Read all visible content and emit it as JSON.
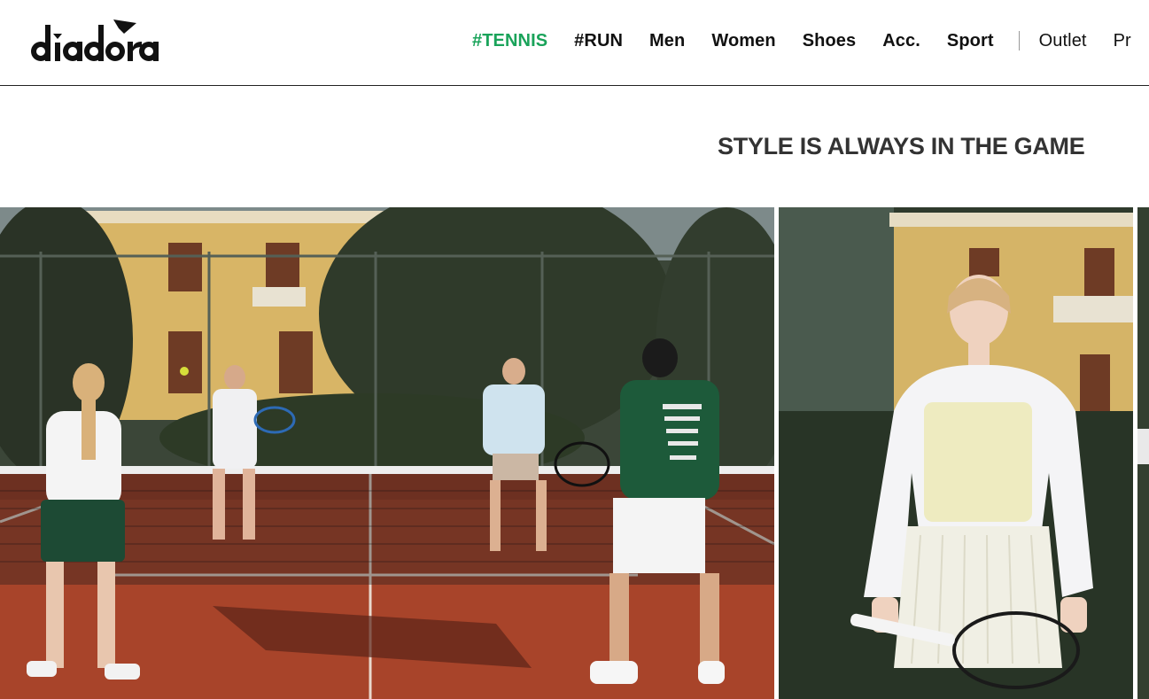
{
  "brand": {
    "logo_text": "diadora"
  },
  "nav": {
    "items": [
      {
        "label": "#TENNIS"
      },
      {
        "label": "#RUN"
      },
      {
        "label": "Men"
      },
      {
        "label": "Women"
      },
      {
        "label": "Shoes"
      },
      {
        "label": "Acc."
      },
      {
        "label": "Sport"
      },
      {
        "label": "Outlet"
      },
      {
        "label": "Pr"
      }
    ],
    "active_color": "#1aa35a"
  },
  "main": {
    "headline": "STYLE IS ALWAYS IN THE GAME"
  },
  "gallery": {
    "images": [
      {
        "subject": "players-on-clay-tennis-court"
      },
      {
        "subject": "player-portrait-with-racket"
      },
      {
        "subject": "next-image-partial"
      }
    ],
    "colors": {
      "clay": "#a8442a",
      "fence": "#3a4a3c",
      "villa": "#d8b566",
      "jacket": "#f2f2f4",
      "green_sweater": "#1d5a3a"
    }
  }
}
